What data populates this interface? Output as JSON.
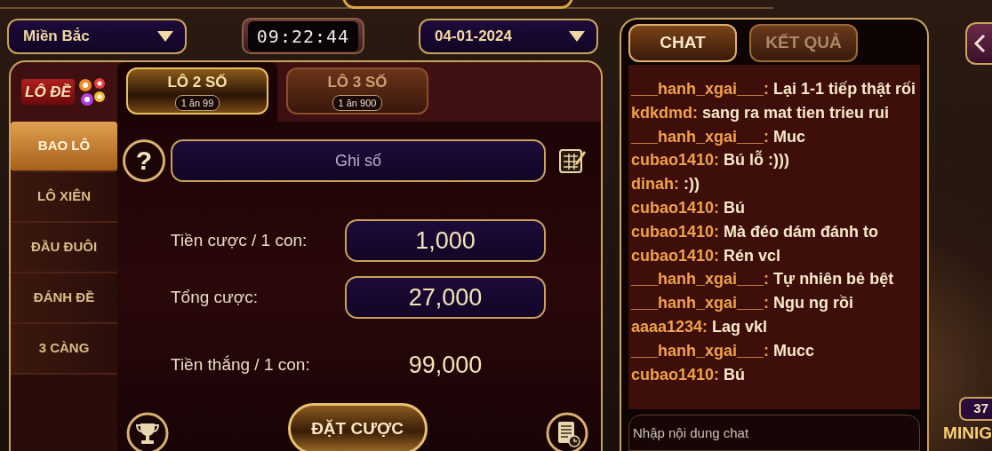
{
  "top_bar": {
    "region": {
      "value": "Miền Bắc"
    },
    "clock": "09:22:44",
    "date": {
      "value": "04-01-2024"
    }
  },
  "bet_panel": {
    "logo": "LÔ ĐỀ",
    "tabs": [
      {
        "label": "LÔ 2 SỐ",
        "odds": "1 ăn 99",
        "selected": true
      },
      {
        "label": "LÔ 3 SỐ",
        "odds": "1 ăn 900",
        "selected": false
      }
    ],
    "categories": [
      {
        "label": "BAO LÔ",
        "selected": true
      },
      {
        "label": "LÔ XIÊN",
        "selected": false
      },
      {
        "label": "ĐẦU ĐUÔI",
        "selected": false
      },
      {
        "label": "ĐÁNH ĐỀ",
        "selected": false
      },
      {
        "label": "3 CÀNG",
        "selected": false
      }
    ],
    "help": "?",
    "number_field": {
      "placeholder": "Ghi số"
    },
    "stake": {
      "label": "Tiền cược / 1 con:",
      "value": "1,000"
    },
    "total": {
      "label": "Tổng cược:",
      "value": "27,000"
    },
    "win": {
      "label": "Tiền thắng / 1 con:",
      "value": "99,000"
    },
    "submit": "ĐẶT CƯỢC"
  },
  "chat": {
    "tabs": [
      {
        "label": "CHAT",
        "selected": true
      },
      {
        "label": "KẾT QUẢ",
        "selected": false
      }
    ],
    "messages": [
      {
        "user": "___hanh_xgai___:",
        "text": "Lại 1-1 tiếp thật rối"
      },
      {
        "user": "kdkdmd:",
        "text": "sang ra mat tien trieu rui"
      },
      {
        "user": "___hanh_xgai___:",
        "text": "Muc"
      },
      {
        "user": "cubao1410:",
        "text": "Bú lỗ :)))"
      },
      {
        "user": "dinah:",
        "text": ":))"
      },
      {
        "user": "cubao1410:",
        "text": "Bú"
      },
      {
        "user": "cubao1410:",
        "text": "Mà đéo dám đánh to"
      },
      {
        "user": "cubao1410:",
        "text": "Rén vcl"
      },
      {
        "user": "___hanh_xgai___:",
        "text": "Tự nhiên bẻ bệt"
      },
      {
        "user": "___hanh_xgai___:",
        "text": "Ngu ng rồi"
      },
      {
        "user": "aaaa1234:",
        "text": "Lag vkl"
      },
      {
        "user": "___hanh_xgai___:",
        "text": "Mucc"
      },
      {
        "user": "cubao1410:",
        "text": "Bú"
      }
    ],
    "input": {
      "placeholder": "Nhập nội dung chat"
    }
  },
  "minigame": {
    "count": "37",
    "label": "MINIG"
  }
}
